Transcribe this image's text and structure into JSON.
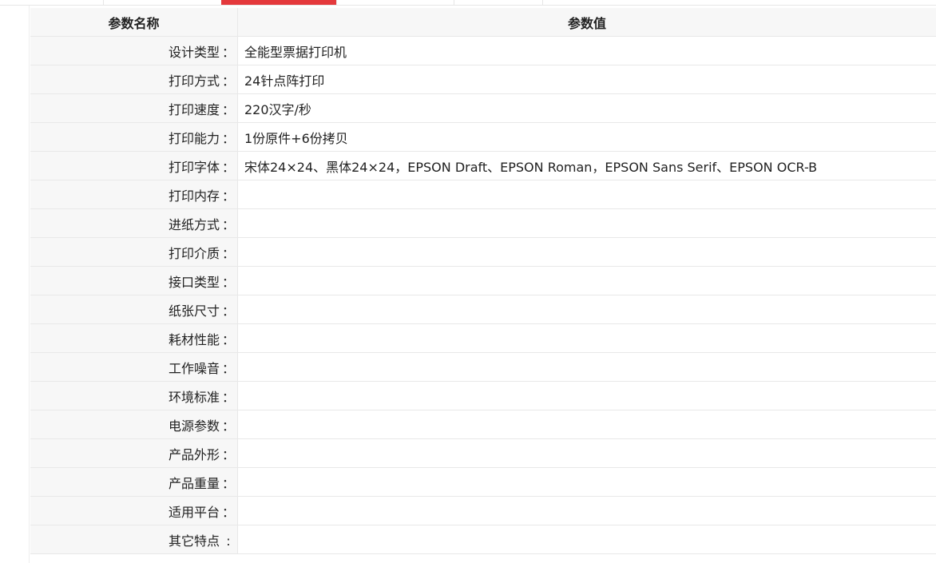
{
  "header": {
    "name_col": "参数名称",
    "value_col": "参数值"
  },
  "rows": [
    {
      "name": "设计类型",
      "colon": "：",
      "value": "全能型票据打印机"
    },
    {
      "name": "打印方式",
      "colon": "：",
      "value": "24针点阵打印"
    },
    {
      "name": "打印速度",
      "colon": "：",
      "value": "220汉字/秒"
    },
    {
      "name": "打印能力",
      "colon": "：",
      "value": "1份原件+6份拷贝"
    },
    {
      "name": "打印字体",
      "colon": "：",
      "value": "宋体24×24、黑体24×24，EPSON Draft、EPSON Roman，EPSON Sans Serif、EPSON OCR-B"
    },
    {
      "name": "打印内存",
      "colon": "：",
      "value": ""
    },
    {
      "name": "进纸方式",
      "colon": "：",
      "value": ""
    },
    {
      "name": "打印介质",
      "colon": "：",
      "value": ""
    },
    {
      "name": "接口类型",
      "colon": "：",
      "value": ""
    },
    {
      "name": "纸张尺寸",
      "colon": "：",
      "value": ""
    },
    {
      "name": "耗材性能",
      "colon": "：",
      "value": ""
    },
    {
      "name": "工作噪音",
      "colon": "：",
      "value": ""
    },
    {
      "name": "环境标准",
      "colon": "：",
      "value": ""
    },
    {
      "name": "电源参数",
      "colon": "：",
      "value": ""
    },
    {
      "name": "产品外形",
      "colon": "：",
      "value": ""
    },
    {
      "name": "产品重量",
      "colon": "：",
      "value": ""
    },
    {
      "name": "适用平台",
      "colon": "：",
      "value": ""
    },
    {
      "name": "其它特点",
      "colon": ":",
      "value": ""
    }
  ],
  "colors": {
    "active_tab": "#e4393c",
    "header_bg": "#f7f7f7",
    "border": "#e8e8e8"
  }
}
